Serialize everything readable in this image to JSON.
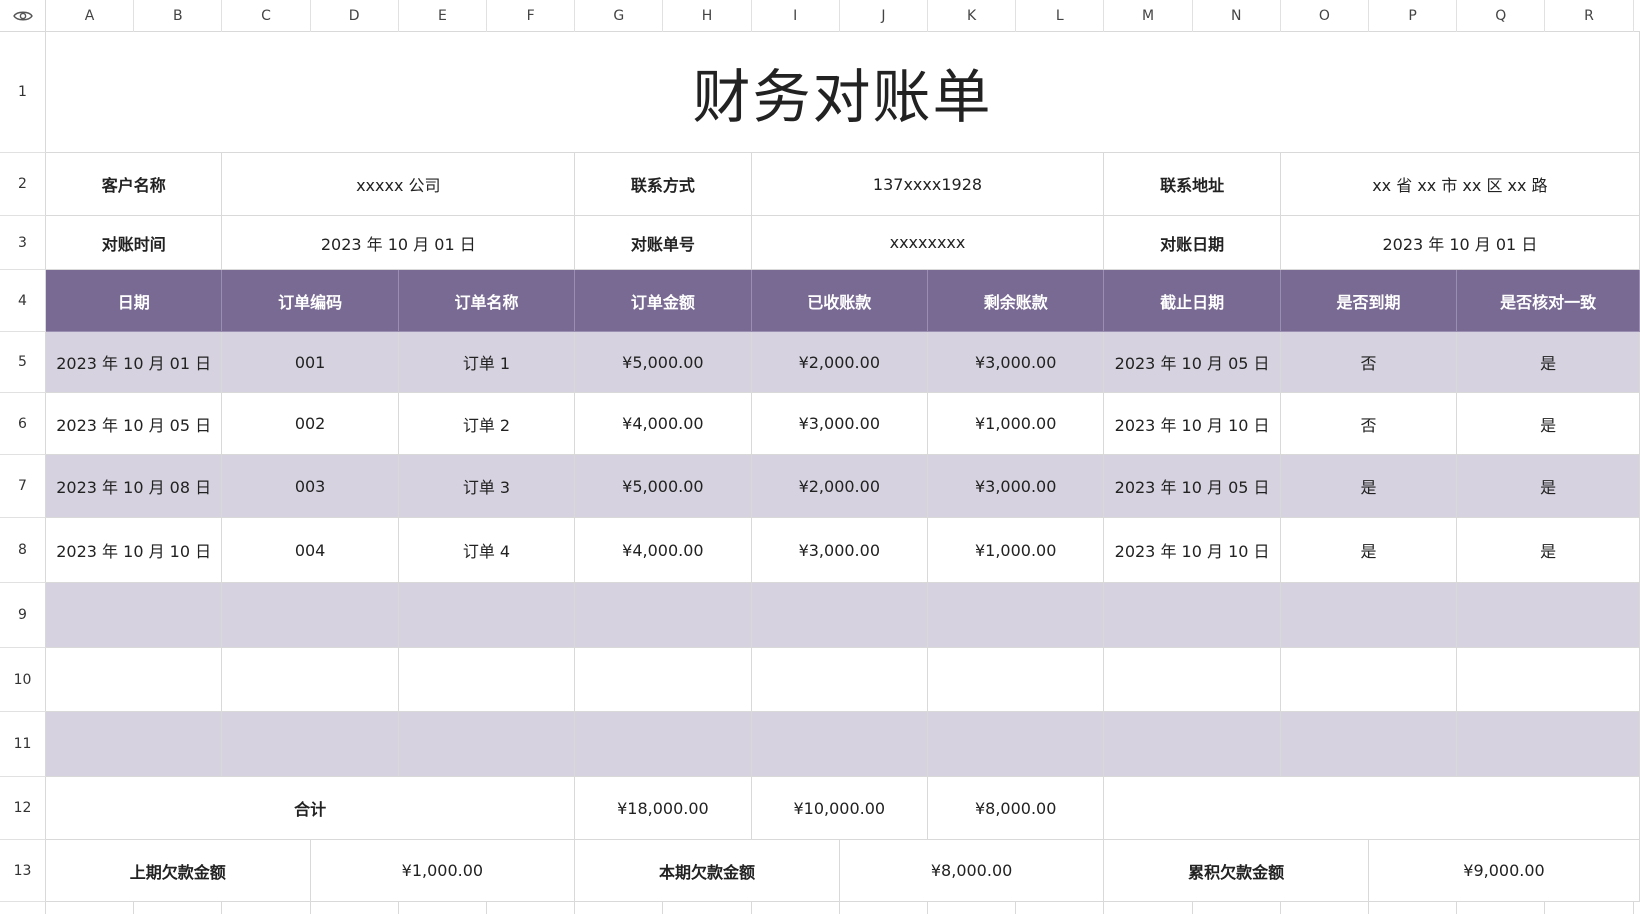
{
  "columns": [
    "A",
    "B",
    "C",
    "D",
    "E",
    "F",
    "G",
    "H",
    "I",
    "J",
    "K",
    "L",
    "M",
    "N",
    "O",
    "P",
    "Q",
    "R"
  ],
  "rows": [
    "1",
    "2",
    "3",
    "4",
    "5",
    "6",
    "7",
    "8",
    "9",
    "10",
    "11",
    "12",
    "13"
  ],
  "title": "财务对账单",
  "info": {
    "customer_label": "客户名称",
    "customer_value": "xxxxx 公司",
    "contact_label": "联系方式",
    "contact_value": "137xxxx1928",
    "address_label": "联系地址",
    "address_value": "xx 省 xx 市 xx 区 xx 路",
    "recon_time_label": "对账时间",
    "recon_time_value": "2023 年 10 月 01 日",
    "recon_no_label": "对账单号",
    "recon_no_value": "xxxxxxxx",
    "recon_date_label": "对账日期",
    "recon_date_value": "2023 年 10 月 01 日"
  },
  "table_headers": [
    "日期",
    "订单编码",
    "订单名称",
    "订单金额",
    "已收账款",
    "剩余账款",
    "截止日期",
    "是否到期",
    "是否核对一致"
  ],
  "table_rows": [
    [
      "2023 年 10 月 01 日",
      "001",
      "订单 1",
      "¥5,000.00",
      "¥2,000.00",
      "¥3,000.00",
      "2023 年 10 月 05 日",
      "否",
      "是"
    ],
    [
      "2023 年 10 月 05 日",
      "002",
      "订单 2",
      "¥4,000.00",
      "¥3,000.00",
      "¥1,000.00",
      "2023 年 10 月 10 日",
      "否",
      "是"
    ],
    [
      "2023 年 10 月 08 日",
      "003",
      "订单 3",
      "¥5,000.00",
      "¥2,000.00",
      "¥3,000.00",
      "2023 年 10 月 05 日",
      "是",
      "是"
    ],
    [
      "2023 年 10 月 10 日",
      "004",
      "订单 4",
      "¥4,000.00",
      "¥3,000.00",
      "¥1,000.00",
      "2023 年 10 月 10 日",
      "是",
      "是"
    ]
  ],
  "totals": {
    "label": "合计",
    "order_amount": "¥18,000.00",
    "received": "¥10,000.00",
    "remaining": "¥8,000.00"
  },
  "arrears": {
    "prev_label": "上期欠款金额",
    "prev_value": "¥1,000.00",
    "current_label": "本期欠款金额",
    "current_value": "¥8,000.00",
    "cumulative_label": "累积欠款金额",
    "cumulative_value": "¥9,000.00"
  },
  "colors": {
    "header_bg": "#786a92",
    "band_bg": "#d6d2df"
  }
}
